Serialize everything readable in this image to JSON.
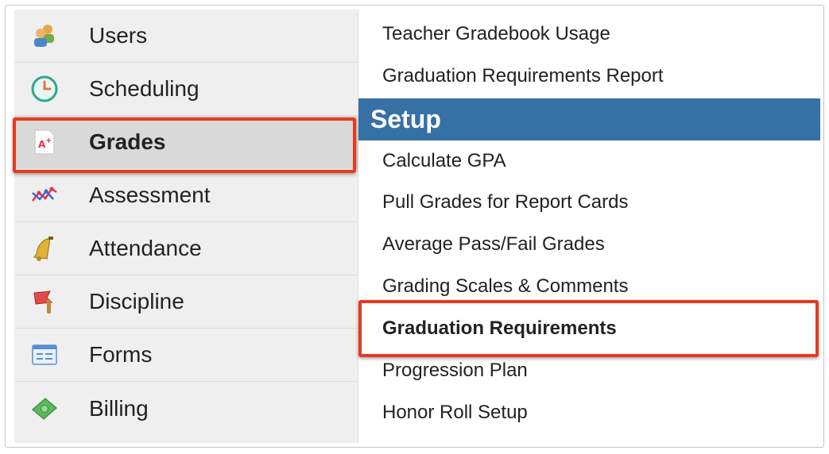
{
  "sidebar": {
    "items": [
      {
        "label": "Users",
        "icon": "users-icon",
        "selected": false
      },
      {
        "label": "Scheduling",
        "icon": "clock-icon",
        "selected": false
      },
      {
        "label": "Grades",
        "icon": "grades-icon",
        "selected": true
      },
      {
        "label": "Assessment",
        "icon": "assessment-chart-icon",
        "selected": false
      },
      {
        "label": "Attendance",
        "icon": "bell-icon",
        "selected": false
      },
      {
        "label": "Discipline",
        "icon": "flag-icon",
        "selected": false
      },
      {
        "label": "Forms",
        "icon": "form-icon",
        "selected": false
      },
      {
        "label": "Billing",
        "icon": "money-icon",
        "selected": false
      }
    ]
  },
  "menu": {
    "top_items": [
      "Teacher Gradebook Usage",
      "Graduation Requirements Report"
    ],
    "section_header": "Setup",
    "setup_items": [
      "Calculate GPA",
      "Pull Grades for Report Cards",
      "Average Pass/Fail Grades",
      "Grading Scales & Comments",
      "Graduation Requirements",
      "Progression Plan",
      "Honor Roll Setup"
    ],
    "active_item": "Graduation Requirements"
  },
  "colors": {
    "header_bg": "#3671a5",
    "callout": "#e8391f",
    "sidebar_bg": "#efefef",
    "selected_bg": "#d9d9d9"
  }
}
